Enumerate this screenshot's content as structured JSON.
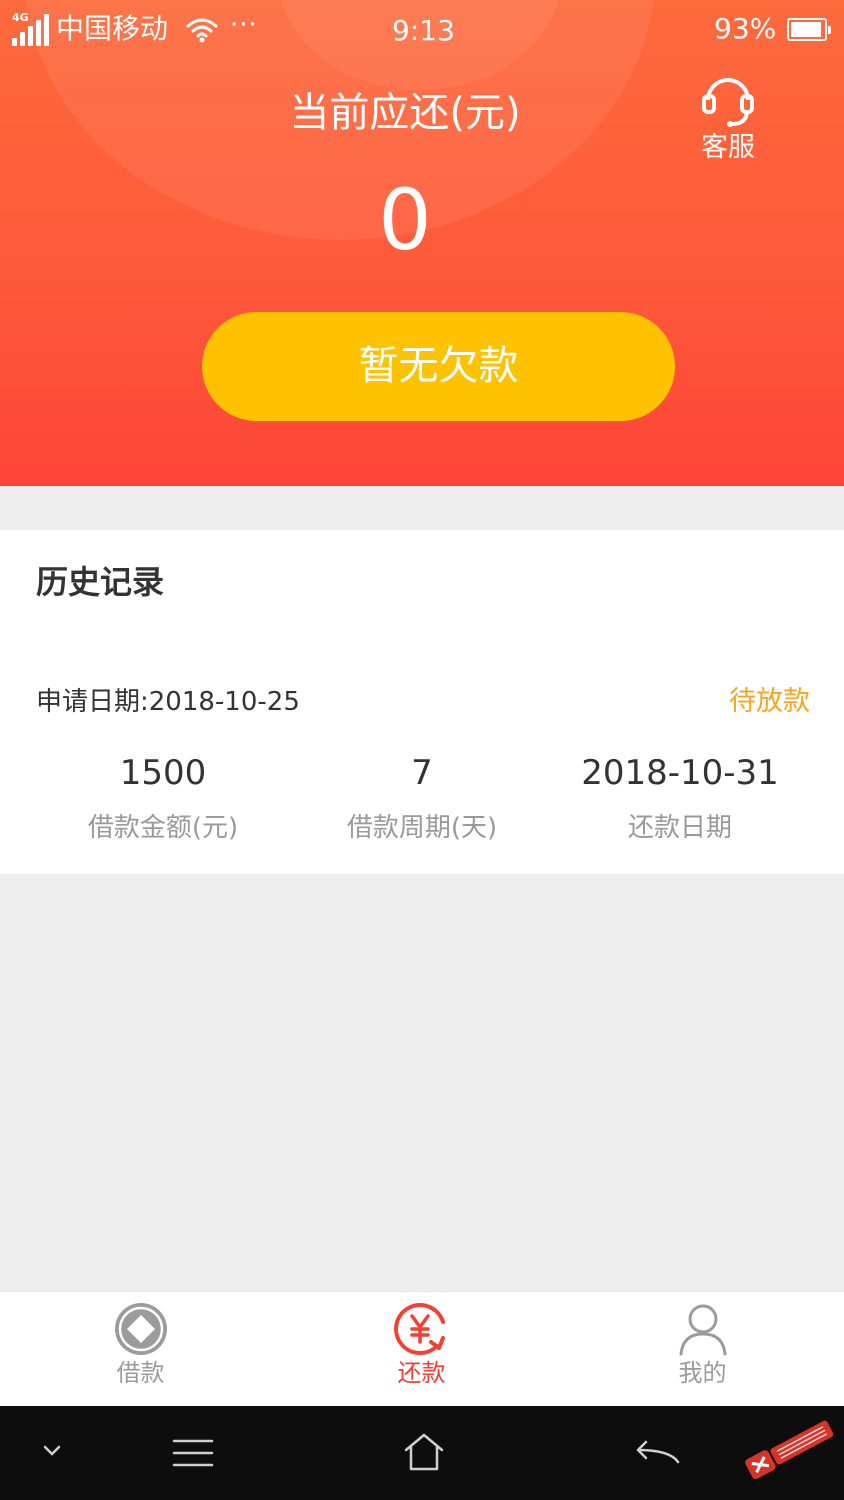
{
  "status_bar": {
    "network": "4G",
    "carrier": "中国移动",
    "more": "···",
    "time": "9:13",
    "battery": "93%",
    "battery_level": 0.93
  },
  "header": {
    "title": "当前应还(元)",
    "amount": "0",
    "service_label": "客服",
    "button_label": "暂无欠款"
  },
  "history": {
    "title": "历史记录",
    "record": {
      "apply_date": "申请日期:2018-10-25",
      "status": "待放款",
      "columns": [
        {
          "value": "1500",
          "label": "借款金额(元)"
        },
        {
          "value": "7",
          "label": "借款周期(天)"
        },
        {
          "value": "2018-10-31",
          "label": "还款日期"
        }
      ]
    }
  },
  "tabs": [
    {
      "label": "借款",
      "icon": "coin-diamond-icon",
      "active": false
    },
    {
      "label": "还款",
      "icon": "yuan-repay-icon",
      "active": true
    },
    {
      "label": "我的",
      "icon": "user-icon",
      "active": false
    }
  ],
  "colors": {
    "header_top": "#fd6a3c",
    "header_bottom": "#fd4537",
    "button": "#fec200",
    "status_pending": "#f5a623",
    "tab_active": "#f43f33",
    "tab_inactive": "#9b9b9b"
  },
  "nav_icons": [
    "chevron-down-icon",
    "menu-icon",
    "home-icon",
    "back-icon"
  ]
}
